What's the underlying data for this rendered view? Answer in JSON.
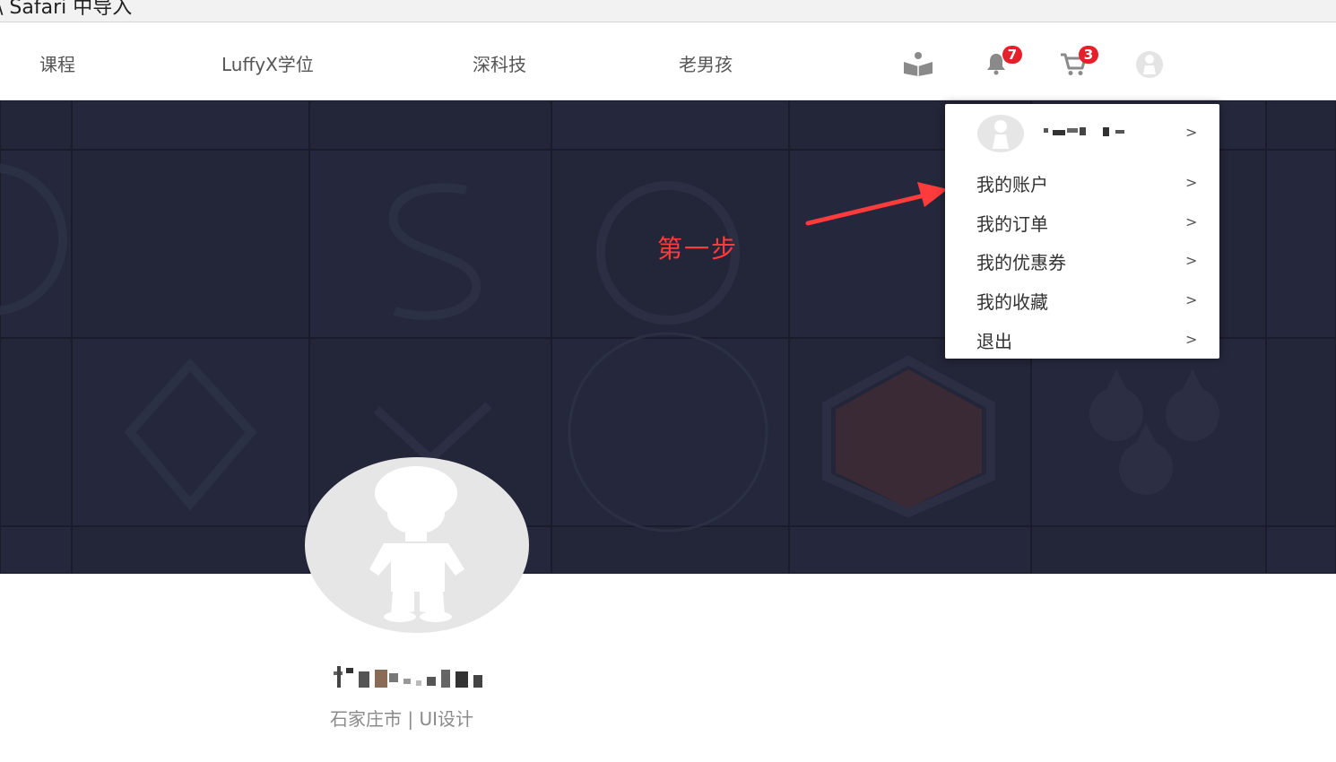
{
  "browser": {
    "top_text": "\\ Safari 中导入"
  },
  "nav": {
    "links": [
      "课程",
      "LuffyX学位",
      "深科技",
      "老男孩"
    ],
    "notifications_count": "7",
    "cart_count": "3",
    "icons": [
      "book-reader-icon",
      "bell-icon",
      "cart-icon",
      "avatar-icon"
    ]
  },
  "annotation": {
    "step_label": "第一步"
  },
  "dropdown": {
    "items": [
      {
        "label": "我的账户",
        "chevron": ">"
      },
      {
        "label": "我的订单",
        "chevron": ">"
      },
      {
        "label": "我的优惠券",
        "chevron": ">"
      },
      {
        "label": "我的收藏",
        "chevron": ">"
      },
      {
        "label": "退出",
        "chevron": ">"
      }
    ],
    "user_chevron": ">"
  },
  "profile": {
    "subtitle": "石家庄市 | UI设计"
  },
  "colors": {
    "accent_red": "#e6202b",
    "annotation_red": "#ff3b3b",
    "banner_bg": "#1e2033"
  }
}
